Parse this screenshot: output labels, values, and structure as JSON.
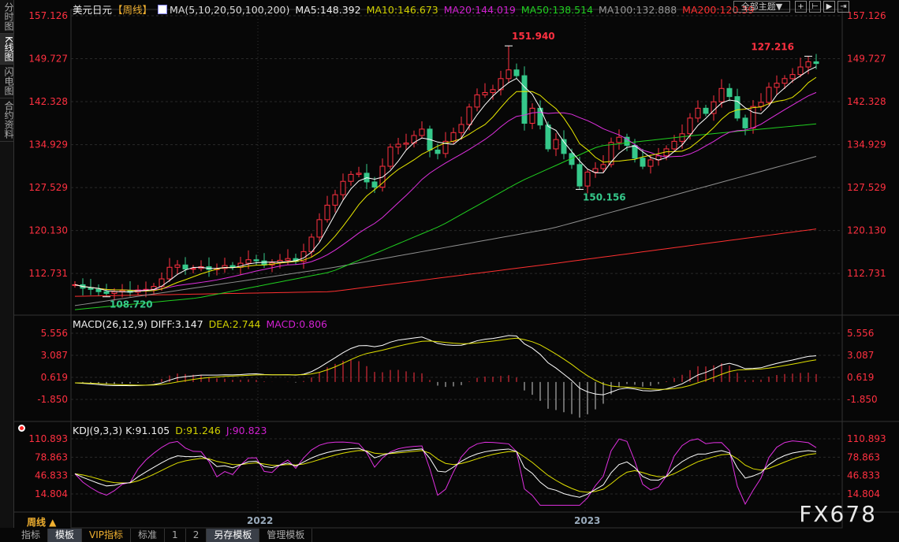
{
  "sidebar": {
    "tabs": [
      "分时图",
      "K线图",
      "闪电图",
      "合约资料"
    ],
    "active": 1
  },
  "header": {
    "symbol": "美元日元",
    "period": "【周线】",
    "ma_label": "MA(5,10,20,50,100,200)",
    "ma5": "MA5:148.392",
    "ma10": "MA10:146.673",
    "ma20": "MA20:144.019",
    "ma50": "MA50:138.514",
    "ma100": "MA100:132.888",
    "ma200": "MA200:120.39",
    "theme_button": "全部主题▼"
  },
  "macd_header": {
    "title": "MACD(26,12,9)",
    "diff": "DIFF:3.147",
    "dea": "DEA:2.744",
    "macd": "MACD:0.806"
  },
  "kdj_header": {
    "title": "KDJ(9,3,3)",
    "k": "K:91.105",
    "d": "D:91.246",
    "j": "J:90.823"
  },
  "colors": {
    "up": "#ff3040",
    "down": "#35c88a",
    "ma5": "#ffffff",
    "ma10": "#e8e800",
    "ma20": "#e030e0",
    "ma50": "#20d020",
    "ma100": "#909090",
    "ma200": "#ff3030"
  },
  "footer": {
    "period": "周线 ▲",
    "years": [
      "2022",
      "2023"
    ],
    "tabs": [
      "指标",
      "模板",
      "VIP指标",
      "标准",
      "1",
      "2",
      "另存模板",
      "管理模板"
    ],
    "watermark": "FX678"
  },
  "chart_data": {
    "type": "candlestick",
    "price_axis": {
      "ticks": [
        157.126,
        149.727,
        142.328,
        134.929,
        127.529,
        120.13,
        112.731
      ]
    },
    "macd_axis": {
      "ticks": [
        5.556,
        3.087,
        0.619,
        -1.85
      ]
    },
    "kdj_axis": {
      "ticks": [
        110.893,
        78.863,
        46.833,
        14.804
      ]
    },
    "annotations": [
      {
        "text": "151.940",
        "type": "high"
      },
      {
        "text": "127.216",
        "type": "low"
      },
      {
        "text": "150.156",
        "type": "high"
      },
      {
        "text": "108.720",
        "type": "low"
      }
    ],
    "closes": [
      110.8,
      110.2,
      110.0,
      109.6,
      109.3,
      109.6,
      109.8,
      109.5,
      109.9,
      110.0,
      110.5,
      111.8,
      113.8,
      114.2,
      113.5,
      113.6,
      113.9,
      113.4,
      113.6,
      114.1,
      113.8,
      114.5,
      115.1,
      114.9,
      114.2,
      114.6,
      115.0,
      115.3,
      114.8,
      116.5,
      119.0,
      122.0,
      124.5,
      126.3,
      128.6,
      129.8,
      130.0,
      128.5,
      127.6,
      131.2,
      134.5,
      135.0,
      135.2,
      136.5,
      137.6,
      134.0,
      133.4,
      135.5,
      137.0,
      138.4,
      141.4,
      143.5,
      143.9,
      144.4,
      146.3,
      147.8,
      146.8,
      138.6,
      141.2,
      138.3,
      134.2,
      135.8,
      133.4,
      131.5,
      127.8,
      130.2,
      130.8,
      131.5,
      135.3,
      136.2,
      134.8,
      132.6,
      131.2,
      132.3,
      133.0,
      134.2,
      135.5,
      136.8,
      139.5,
      141.2,
      140.3,
      142.3,
      144.6,
      143.2,
      139.5,
      137.8,
      141.5,
      142.2,
      144.8,
      145.5,
      146.3,
      147.0,
      148.3,
      149.2,
      148.9
    ],
    "ma50_anchors": [
      [
        0,
        106.5
      ],
      [
        15.5,
        108.5
      ],
      [
        32.5,
        113
      ],
      [
        46.5,
        121
      ],
      [
        56.5,
        128.6
      ],
      [
        66.5,
        134.7
      ],
      [
        78.5,
        136.5
      ],
      [
        94,
        138.5
      ]
    ],
    "ma100_anchors": [
      [
        0,
        107.2
      ],
      [
        32.5,
        113.7
      ],
      [
        60.5,
        120.5
      ],
      [
        94,
        132.9
      ]
    ],
    "ma200_anchors": [
      [
        0,
        108.8
      ],
      [
        32.5,
        109.6
      ],
      [
        60.5,
        114.4
      ],
      [
        94,
        120.4
      ]
    ]
  }
}
